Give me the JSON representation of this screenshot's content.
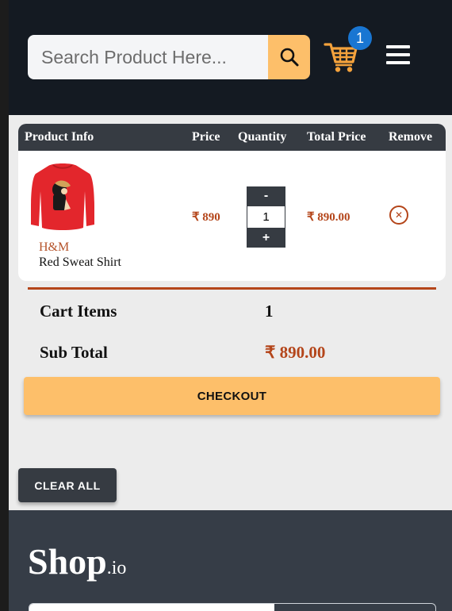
{
  "header": {
    "search_placeholder": "Search Product Here...",
    "cart_count": "1"
  },
  "table": {
    "headers": [
      "Product Info",
      "Price",
      "Quantity",
      "Total Price",
      "Remove"
    ],
    "rows": [
      {
        "brand": "H&M",
        "name": "Red Sweat Shirt",
        "price": "₹ 890",
        "quantity": "1",
        "minus_label": "-",
        "plus_label": "+",
        "total": "₹ 890.00",
        "remove_icon": "close-circle-icon"
      }
    ]
  },
  "summary": {
    "cart_items_label": "Cart Items",
    "cart_items_value": "1",
    "subtotal_label": "Sub Total",
    "subtotal_value": "₹ 890.00"
  },
  "buttons": {
    "checkout": "CHECKOUT",
    "clear_all": "CLEAR ALL"
  },
  "footer": {
    "logo_main": "Shop",
    "logo_suffix": ".io"
  },
  "colors": {
    "header_bg": "#141a22",
    "accent": "#fdbf6a",
    "price": "#b4451a",
    "dark": "#363b42",
    "badge": "#1976d2"
  }
}
